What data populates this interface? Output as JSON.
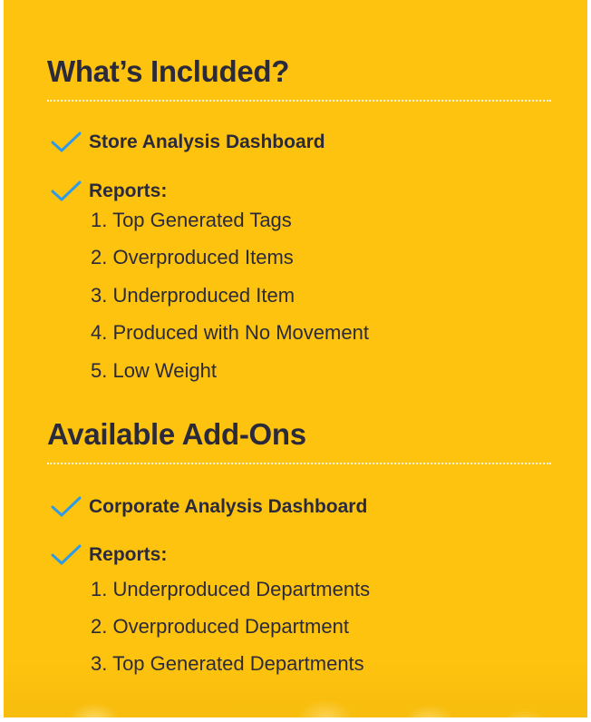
{
  "included": {
    "title": "What’s Included?",
    "items": [
      {
        "label": "Store Analysis Dashboard"
      },
      {
        "label": "Reports:"
      }
    ],
    "reports": [
      "1. Top Generated Tags",
      "2. Overproduced Items",
      "3. Underproduced Item",
      "4. Produced with No Movement",
      "5. Low Weight"
    ]
  },
  "addons": {
    "title": "Available Add-Ons",
    "items": [
      {
        "label": "Corporate Analysis Dashboard"
      },
      {
        "label": "Reports:"
      }
    ],
    "reports": [
      "1. Underproduced Departments",
      "2. Overproduced Department",
      "3. Top Generated Departments"
    ]
  },
  "colors": {
    "background": "#fdc30f",
    "text": "#2b2a3a",
    "check": "#2f9be8",
    "divider": "#ffffff"
  },
  "icons": {
    "check": "checkmark-icon"
  }
}
